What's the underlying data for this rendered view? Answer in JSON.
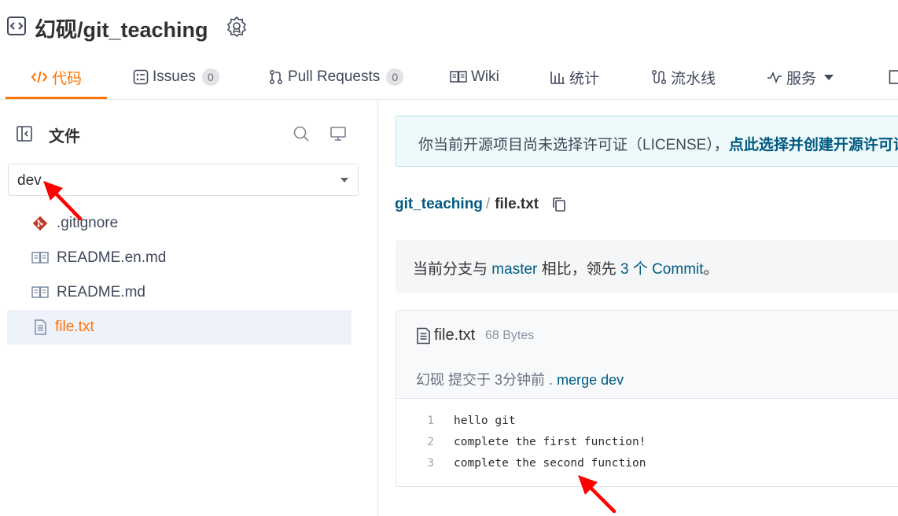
{
  "header": {
    "repo_title": "幻砚/git_teaching"
  },
  "tabs": [
    {
      "label": "代码",
      "icon": "code-icon",
      "active": true
    },
    {
      "label": "Issues",
      "icon": "issues-icon",
      "count": "0"
    },
    {
      "label": "Pull Requests",
      "icon": "pull-request-icon",
      "count": "0"
    },
    {
      "label": "Wiki",
      "icon": "book-icon"
    },
    {
      "label": "统计",
      "icon": "bar-chart-icon"
    },
    {
      "label": "流水线",
      "icon": "pipeline-icon"
    },
    {
      "label": "服务",
      "icon": "pulse-icon"
    }
  ],
  "sidebar": {
    "title": "文件",
    "branch": "dev",
    "files": [
      {
        "name": ".gitignore",
        "icon": "git-icon"
      },
      {
        "name": "README.en.md",
        "icon": "book-icon"
      },
      {
        "name": "README.md",
        "icon": "book-icon"
      },
      {
        "name": "file.txt",
        "icon": "file-text-icon",
        "selected": true
      }
    ]
  },
  "license_banner": {
    "text": "你当前开源项目尚未选择许可证（LICENSE），",
    "link": "点此选择并创建开源许可证"
  },
  "breadcrumb": {
    "repo": "git_teaching",
    "separator": "/",
    "file": "file.txt"
  },
  "branch_compare": {
    "prefix": "当前分支与",
    "base": "master",
    "middle": "相比，领先",
    "count_link": "3 个 Commit",
    "suffix": "。"
  },
  "file_view": {
    "name": "file.txt",
    "size": "68 Bytes",
    "author": "幻砚",
    "committed_text": "提交于",
    "time": "3分钟前",
    "dot": ".",
    "commit_message": "merge dev",
    "lines": [
      {
        "no": "1",
        "text": "hello git"
      },
      {
        "no": "2",
        "text": "complete the first function!"
      },
      {
        "no": "3",
        "text": "complete the second function"
      }
    ]
  },
  "colors": {
    "accent": "#fe7300",
    "link": "#005980",
    "annotation_arrow": "#ff0000"
  }
}
